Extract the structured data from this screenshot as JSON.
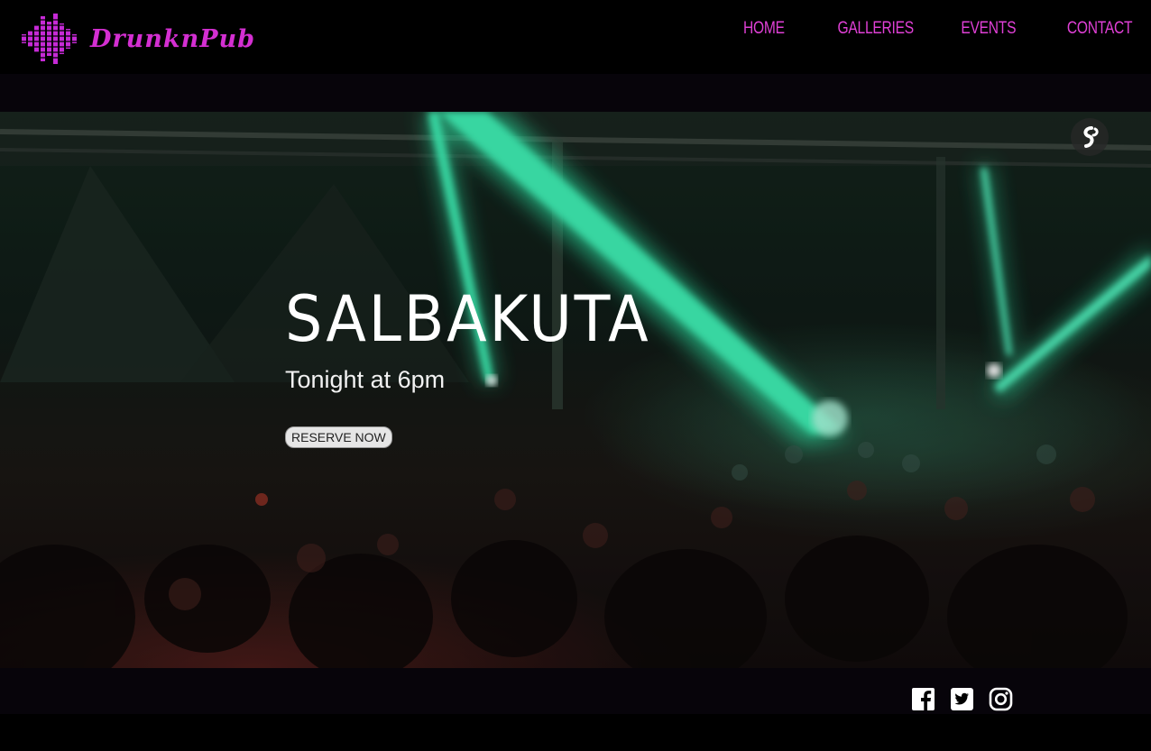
{
  "brand": {
    "name": "DrunknPub",
    "color": "#d42fd2"
  },
  "nav": {
    "items": [
      {
        "label": "HOME"
      },
      {
        "label": "GALLERIES"
      },
      {
        "label": "EVENTS"
      },
      {
        "label": "CONTACT"
      }
    ],
    "color": "#e040d6"
  },
  "hero": {
    "title": "SALBAKUTA",
    "subtitle": "Tonight at 6pm",
    "cta_label": "RESERVE NOW",
    "badge_icon": "sound-wave-icon"
  },
  "footer": {
    "social": [
      {
        "icon": "facebook-icon"
      },
      {
        "icon": "twitter-icon"
      },
      {
        "icon": "instagram-icon"
      }
    ]
  }
}
